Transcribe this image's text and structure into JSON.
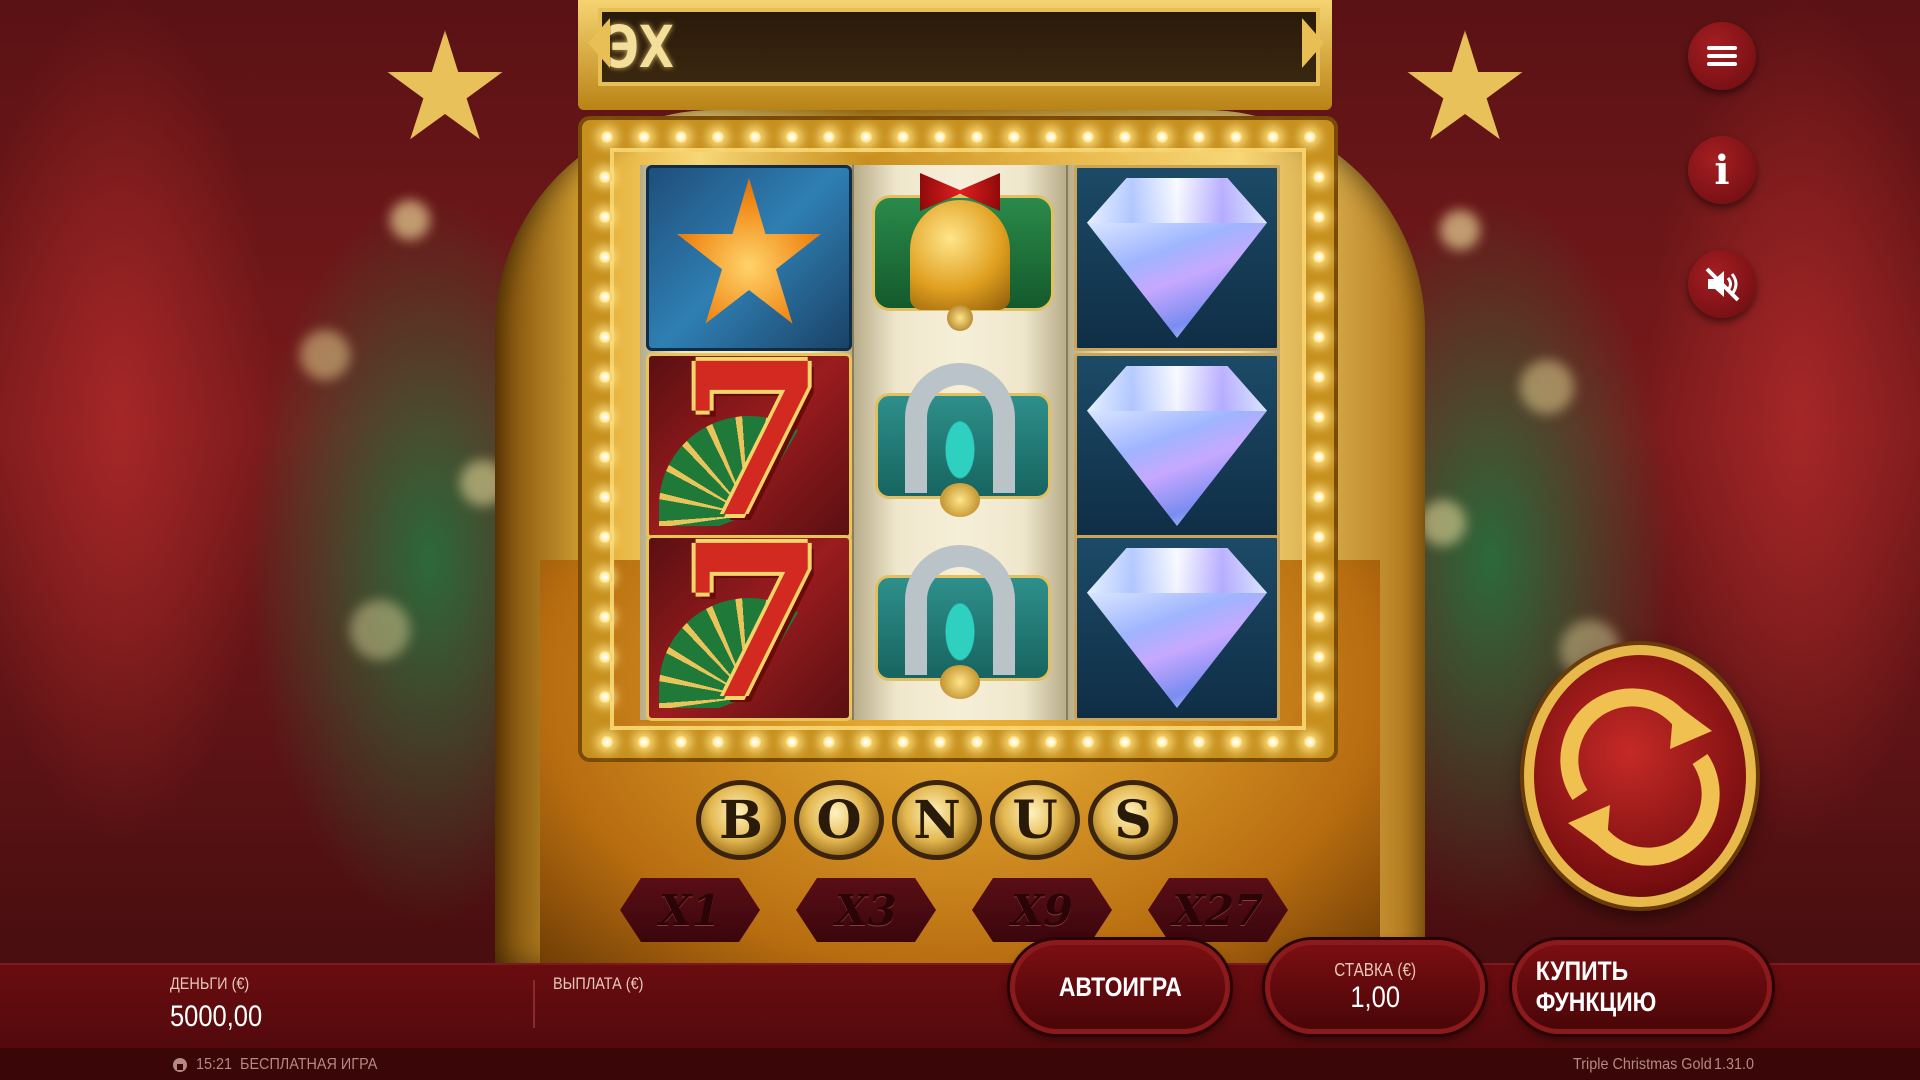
{
  "game": {
    "message": "ЭX",
    "bonus_letters": [
      "B",
      "O",
      "N",
      "U",
      "S"
    ],
    "multipliers": [
      "X1",
      "X3",
      "X9",
      "X27"
    ],
    "reels": [
      [
        "star",
        "seven",
        "seven"
      ],
      [
        "bell",
        "horseshoe",
        "horseshoe"
      ],
      [
        "diamond",
        "diamond",
        "diamond"
      ]
    ]
  },
  "side_buttons": {
    "menu_icon": "menu-icon",
    "info_icon": "info-icon",
    "info_label": "i",
    "sound_icon": "sound-muted-icon",
    "spin_icon": "spin-arrows-icon"
  },
  "bottom": {
    "balance_label": "ДЕНЬГИ (€)",
    "balance_value": "5000,00",
    "payout_label": "ВЫПЛАТА (€)",
    "autoplay_label": "АВТОИГРА",
    "bet_label": "СТАВКА (€)",
    "bet_value": "1,00",
    "buy_feature_label": "КУПИТЬ ФУНКЦИЮ"
  },
  "footer": {
    "time": "15:21",
    "mode": "БЕСПЛАТНАЯ ИГРА",
    "game_title": "Triple Christmas Gold",
    "version": "1.31.0"
  },
  "colors": {
    "accent_gold": "#e7b84a",
    "deep_red": "#6a0c10",
    "spin_red": "#c52a26"
  }
}
